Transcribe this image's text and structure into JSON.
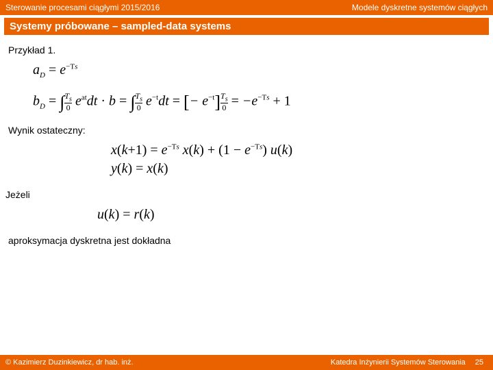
{
  "header": {
    "left": "Sterowanie procesami ciągłymi 2015/2016",
    "right": "Modele dyskretne systemów ciągłych"
  },
  "title": "Systemy próbowane – sampled-data systems",
  "labels": {
    "example": "Przykład 1.",
    "result": "Wynik ostateczny:",
    "if": "Jeżeli",
    "approx": "aproksymacja dyskretna jest dokładna"
  },
  "footer": {
    "left": "©  Kazimierz Duzinkiewicz, dr hab. inż.",
    "right": "Katedra Inżynierii Systemów Sterowania",
    "page": "25"
  },
  "chart_data": {
    "type": "table",
    "equations": [
      "a_D = e^{-T_s}",
      "b_D = \\int_0^{T_s} e^{at} dt \\cdot b = \\int_0^{T_s} e^{-t} dt = [-e^{-t}]_0^{T_s} = -e^{-T_s} + 1",
      "x(k+1) = e^{-T_s} x(k) + (1 - e^{-T_s}) u(k)",
      "y(k) = x(k)",
      "u(k) = r(k)"
    ]
  }
}
